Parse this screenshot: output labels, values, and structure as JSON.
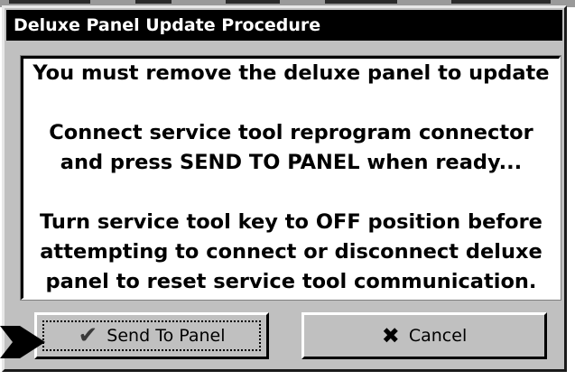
{
  "dialog": {
    "title": "Deluxe Panel Update Procedure",
    "message": {
      "line1": "You must remove the deluxe panel to update",
      "line2": "Connect service tool reprogram connector",
      "line3": "and press SEND TO PANEL when ready...",
      "line4": "Turn service tool key to OFF position before",
      "line5": "attempting to connect or disconnect deluxe",
      "line6": "panel to reset service tool communication."
    },
    "buttons": {
      "send": {
        "label": "Send To Panel",
        "icon": "checkmark-icon"
      },
      "cancel": {
        "label": "Cancel",
        "icon": "x-icon"
      }
    }
  },
  "colors": {
    "title_bar": "#000000",
    "title_text": "#ffffff",
    "dialog_face": "#c0c0c0",
    "message_bg": "#ffffff"
  }
}
